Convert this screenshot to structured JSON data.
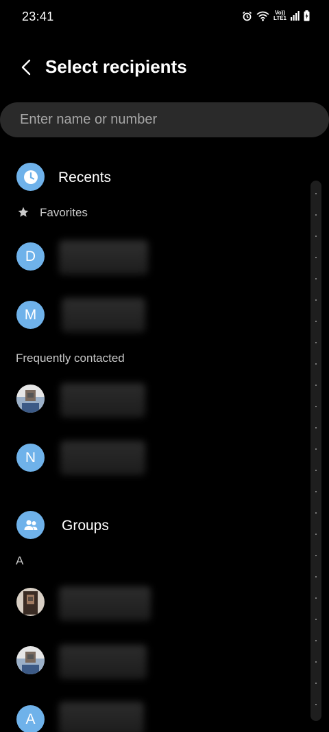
{
  "status_bar": {
    "time": "23:41",
    "volte_top": "Vo))",
    "volte_bottom": "LTE1"
  },
  "header": {
    "title": "Select recipients"
  },
  "search": {
    "placeholder": "Enter name or number",
    "value": ""
  },
  "recents": {
    "label": "Recents"
  },
  "favorites": {
    "label": "Favorites",
    "contacts": [
      {
        "initial": "D"
      },
      {
        "initial": "M"
      }
    ]
  },
  "frequent": {
    "label": "Frequently contacted",
    "contacts": [
      {
        "initial": ""
      },
      {
        "initial": "N"
      }
    ]
  },
  "groups": {
    "label": "Groups"
  },
  "section_a": {
    "label": "A",
    "contacts": [
      {
        "initial": ""
      },
      {
        "initial": ""
      },
      {
        "initial": "A"
      }
    ]
  },
  "colors": {
    "background": "#000000",
    "accent": "#6fb2ea",
    "search_bg": "#2a2a2a",
    "secondary_text": "#c9c9c9"
  },
  "icons": {
    "back": "back-chevron-icon",
    "recents": "clock-icon",
    "favorites": "star-icon",
    "groups": "people-icon"
  }
}
